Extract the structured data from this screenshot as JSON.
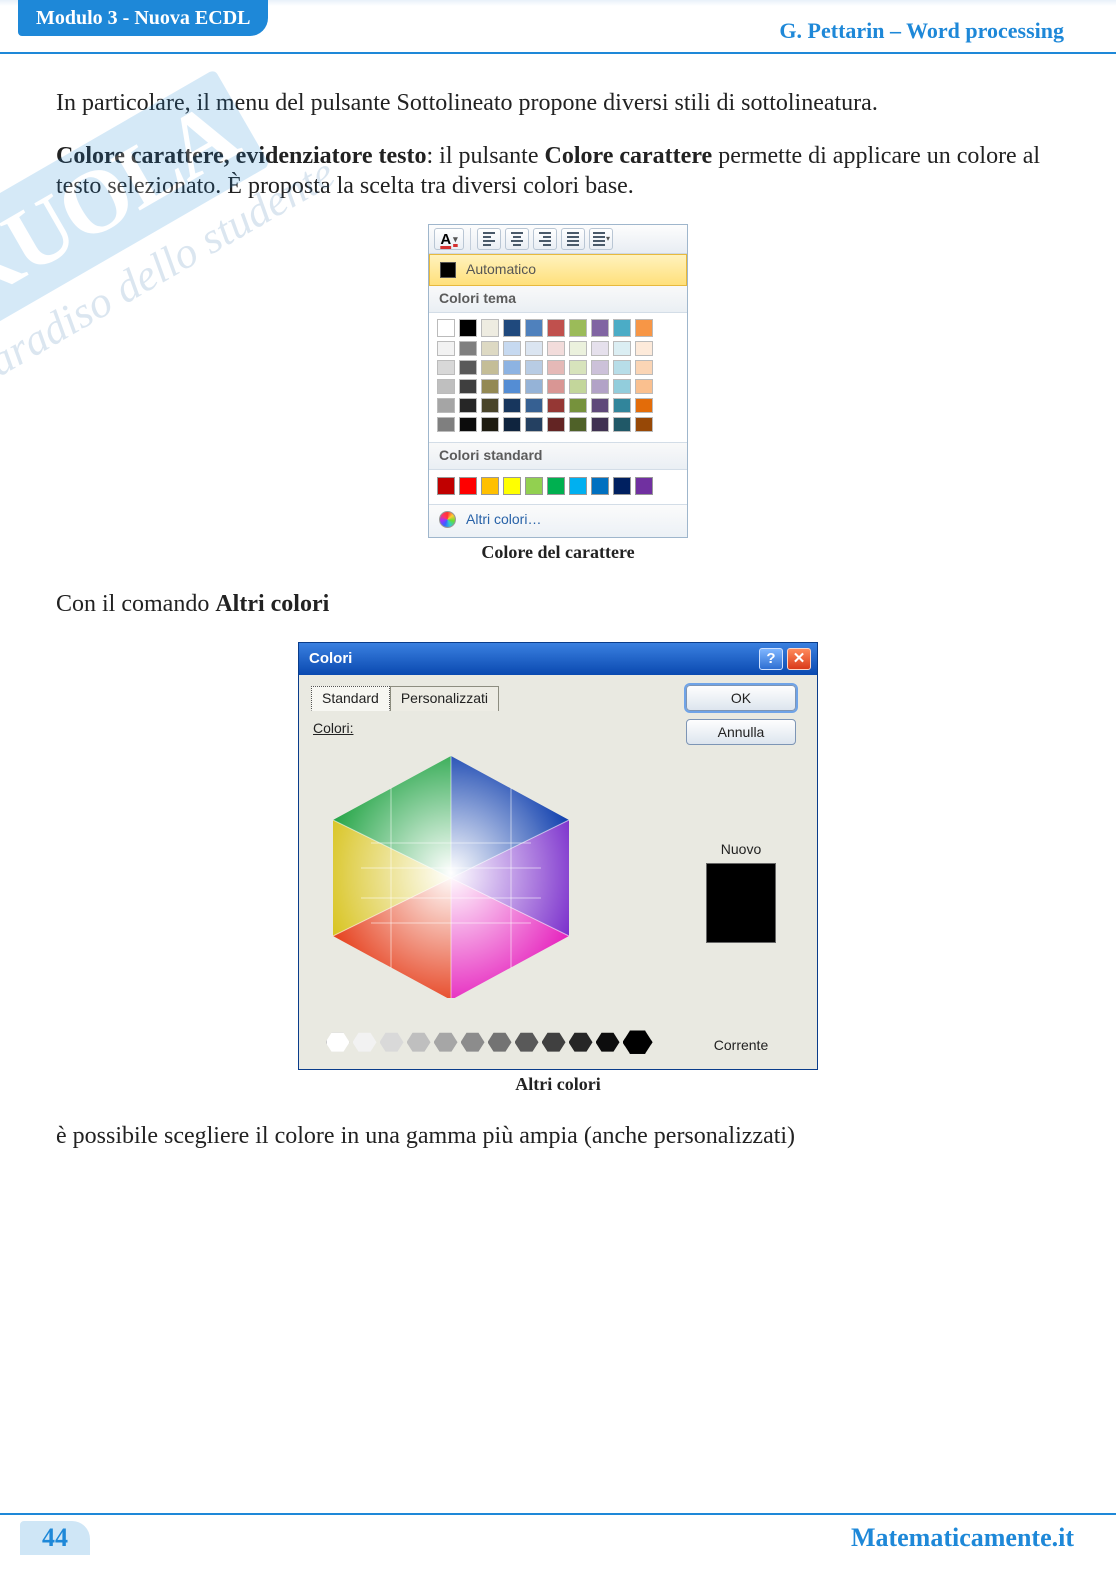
{
  "header": {
    "left": "Modulo 3 - Nuova ECDL",
    "right": "G. Pettarin – Word processing"
  },
  "watermark": {
    "brand": "SKUOLA",
    "slogan": "il paradiso dello studente"
  },
  "p1": "In particolare, il menu del pulsante Sottolineato propone diversi stili di sottolineatura.",
  "p2": {
    "b1": "Colore carattere, evidenziatore testo",
    "mid": ": il pulsante ",
    "b2": "Colore carattere",
    "tail": " permette di applicare un colore al testo selezionato. È proposta la scelta tra diversi colori base."
  },
  "fig1": {
    "ribbon_A": "A",
    "automatic": "Automatico",
    "theme_label": "Colori tema",
    "standard_label": "Colori standard",
    "more_label": "Altri colori…",
    "caption": "Colore del carattere",
    "theme_row": [
      "#ffffff",
      "#000000",
      "#eeece1",
      "#1f497d",
      "#4f81bd",
      "#c0504d",
      "#9bbb59",
      "#8064a2",
      "#4bacc6",
      "#f79646"
    ],
    "theme_shades": [
      [
        "#f2f2f2",
        "#7f7f7f",
        "#ddd9c3",
        "#c6d9f0",
        "#dbe5f1",
        "#f2dcdb",
        "#ebf1dd",
        "#e5e0ec",
        "#dbeef3",
        "#fdeada"
      ],
      [
        "#d8d8d8",
        "#595959",
        "#c4bd97",
        "#8db3e2",
        "#b8cce4",
        "#e5b9b7",
        "#d7e3bc",
        "#ccc1d9",
        "#b7dde8",
        "#fbd5b5"
      ],
      [
        "#bfbfbf",
        "#3f3f3f",
        "#938953",
        "#548dd4",
        "#95b3d7",
        "#d99694",
        "#c3d69b",
        "#b2a2c7",
        "#92cddc",
        "#fac08f"
      ],
      [
        "#a5a5a5",
        "#262626",
        "#494429",
        "#17365d",
        "#366092",
        "#953734",
        "#76923c",
        "#5f497a",
        "#31859b",
        "#e36c09"
      ],
      [
        "#7f7f7f",
        "#0c0c0c",
        "#1d1b10",
        "#0f243e",
        "#244061",
        "#632423",
        "#4f6128",
        "#3f3151",
        "#205867",
        "#974806"
      ]
    ],
    "standard_row": [
      "#c00000",
      "#ff0000",
      "#ffc000",
      "#ffff00",
      "#92d050",
      "#00b050",
      "#00b0f0",
      "#0070c0",
      "#002060",
      "#7030a0"
    ]
  },
  "p3": {
    "a": "Con il comando ",
    "b": "Altri colori"
  },
  "fig2": {
    "title": "Colori",
    "help": "?",
    "close": "✕",
    "tab_standard": "Standard",
    "tab_custom": "Personalizzati",
    "label_colors": "Colori:",
    "ok": "OK",
    "cancel": "Annulla",
    "new": "Nuovo",
    "current": "Corrente",
    "caption": "Altri colori",
    "gray_scale": [
      "#ffffff",
      "#f2f2f2",
      "#d9d9d9",
      "#bfbfbf",
      "#a6a6a6",
      "#8c8c8c",
      "#737373",
      "#595959",
      "#404040",
      "#262626",
      "#0d0d0d"
    ]
  },
  "p4": "è possibile scegliere il colore in una gamma più ampia (anche personalizzati)",
  "footer": {
    "page": "44",
    "site": "Matematicamente.it"
  }
}
